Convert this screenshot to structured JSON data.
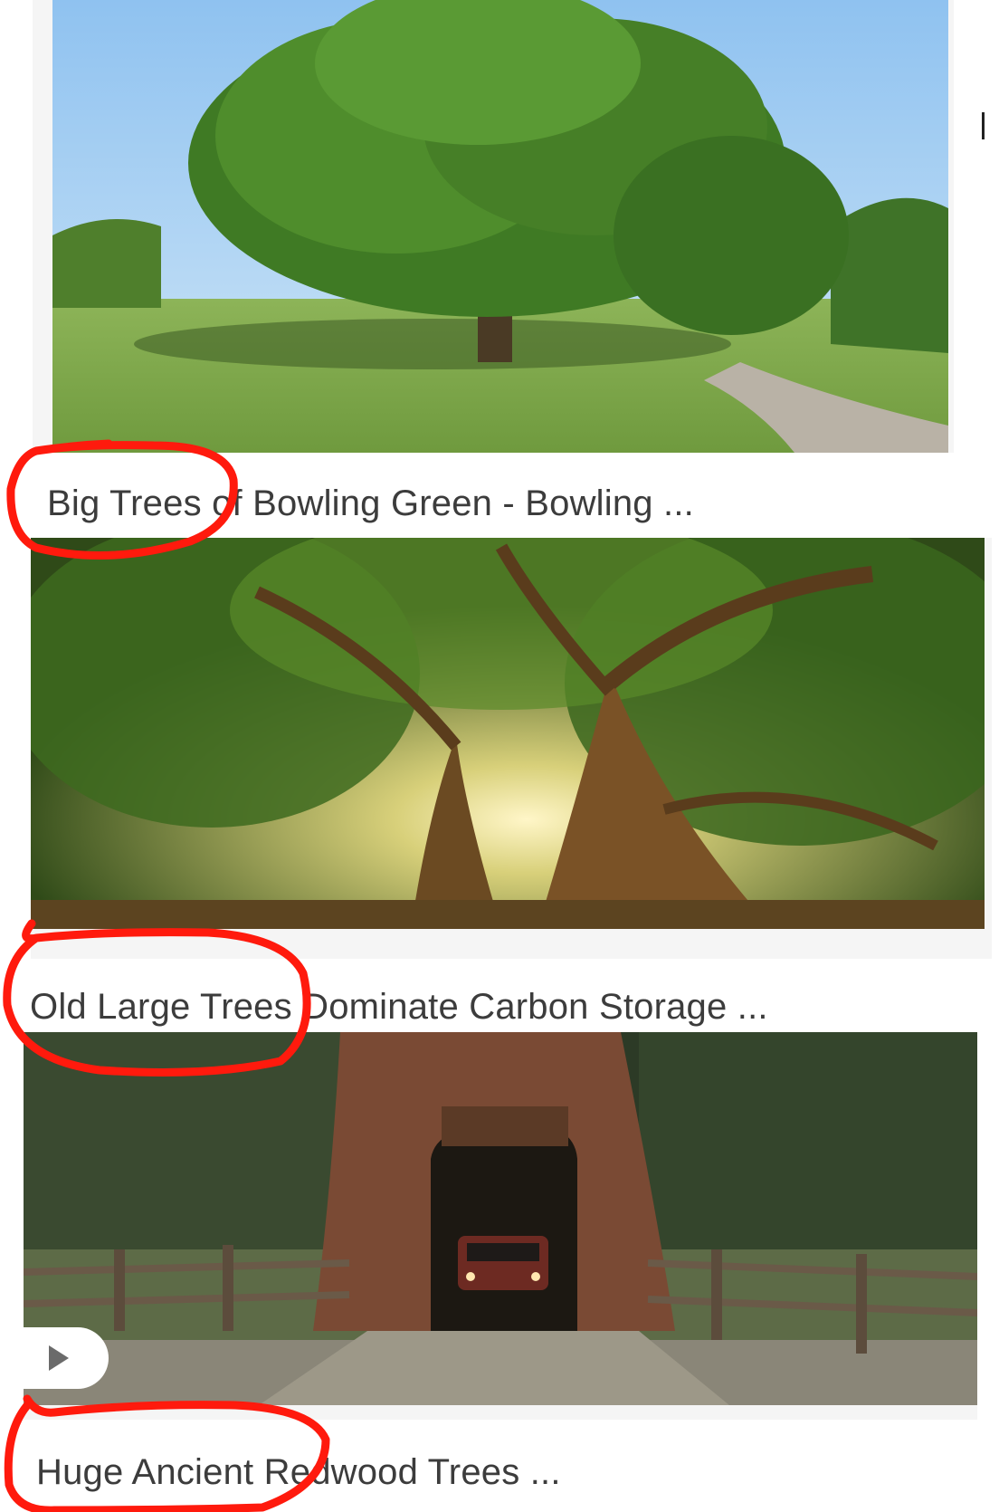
{
  "results": [
    {
      "caption": "Big Trees of Bowling Green - Bowling ...",
      "image": "large-shade-tree-in-park-photo"
    },
    {
      "caption": "Old Large Trees Dominate Carbon Storage ...",
      "image": "two-old-trees-with-sunlight-photo"
    },
    {
      "caption": "Huge Ancient Redwood Trees ...",
      "image": "car-driving-through-redwood-tree-photo",
      "has_video": true
    }
  ],
  "play_icon": "play-icon",
  "annotation_color": "#ff1a0d",
  "annotation_circled_words": [
    "Big Trees",
    "Old Large Trees",
    "Huge Ancient"
  ]
}
